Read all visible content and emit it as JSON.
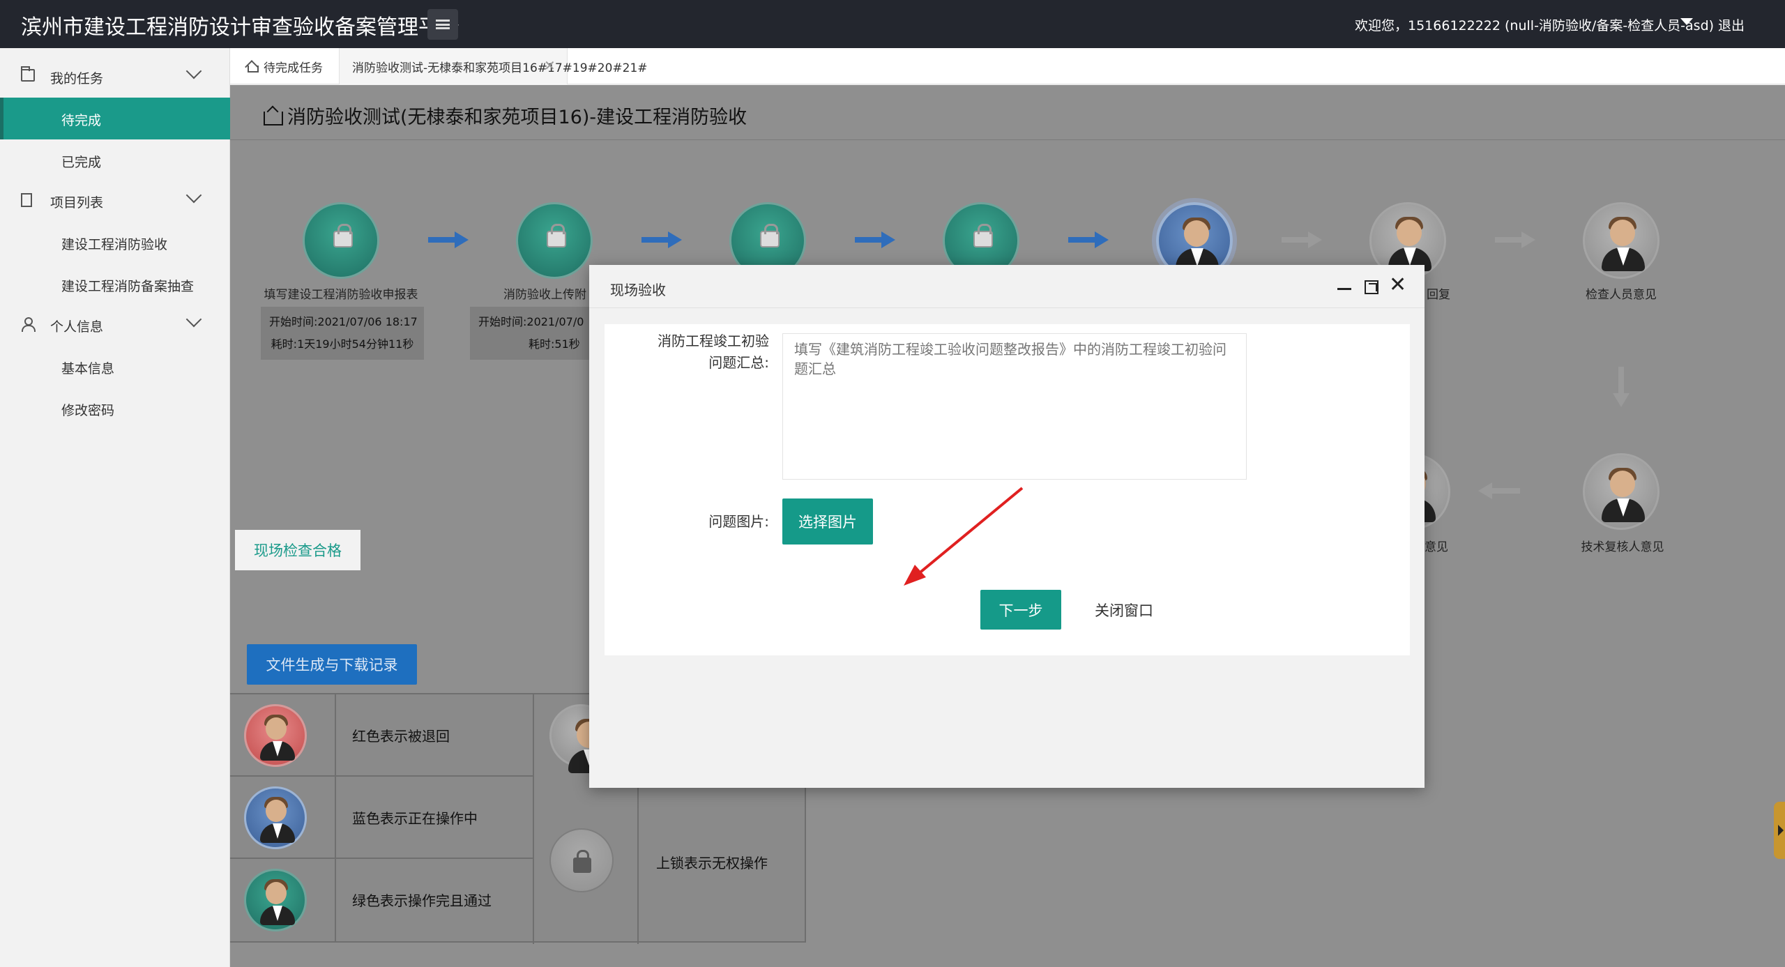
{
  "header": {
    "app_title": "滨州市建设工程消防设计审查验收备案管理平台",
    "greeting": "欢迎您，15166122222 (null-消防验收/备案-检查人员-asd)",
    "logout": "退出"
  },
  "sidebar": {
    "groups": [
      {
        "label": "我的任务",
        "icon": "folder-icon",
        "items": [
          "待完成",
          "已完成"
        ]
      },
      {
        "label": "项目列表",
        "icon": "document-icon",
        "items": [
          "建设工程消防验收",
          "建设工程消防备案抽查"
        ]
      },
      {
        "label": "个人信息",
        "icon": "user-icon",
        "items": [
          "基本信息",
          "修改密码"
        ]
      }
    ],
    "active_item": "待完成"
  },
  "tabs": {
    "home": "待完成任务",
    "active": "消防验收测试-无棣泰和家苑项目16#17#19#20#21#",
    "close": "✕"
  },
  "page": {
    "title": "消防验收测试(无棣泰和家苑项目16)-建设工程消防验收"
  },
  "workflow": {
    "node1_label": "填写建设工程消防验收申报表",
    "node1_start": "开始时间:2021/07/06 18:17",
    "node1_elapsed": "耗时:1天19小时54分钟11秒",
    "node2_label": "消防验收上传附",
    "node2_start": "开始时间:2021/07/0",
    "node2_elapsed": "耗时:51秒",
    "node6_label": "回复",
    "node7_label": "检查人员意见",
    "node8_label": "技术复核人意见",
    "node9_label": "意见"
  },
  "legend": {
    "doc_button": "文件生成与下载记录",
    "red": "红色表示被退回",
    "blue": "蓝色表示正在操作中",
    "green": "绿色表示操作完且通过",
    "lock": "上锁表示无权操作"
  },
  "modal": {
    "title": "现场验收",
    "summary_label_1": "消防工程竣工初验",
    "summary_label_2": "问题汇总:",
    "summary_placeholder": "填写《建筑消防工程竣工验收问题整改报告》中的消防工程竣工初验问题汇总",
    "images_label": "问题图片:",
    "pick_button": "选择图片",
    "pass_button": "现场检查合格",
    "next_button": "下一步",
    "close_button": "关闭窗口"
  },
  "colors": {
    "accent": "#159a89",
    "topbar": "#23262e",
    "link_blue": "#1e6fbf",
    "annotation_red": "#e02020"
  }
}
